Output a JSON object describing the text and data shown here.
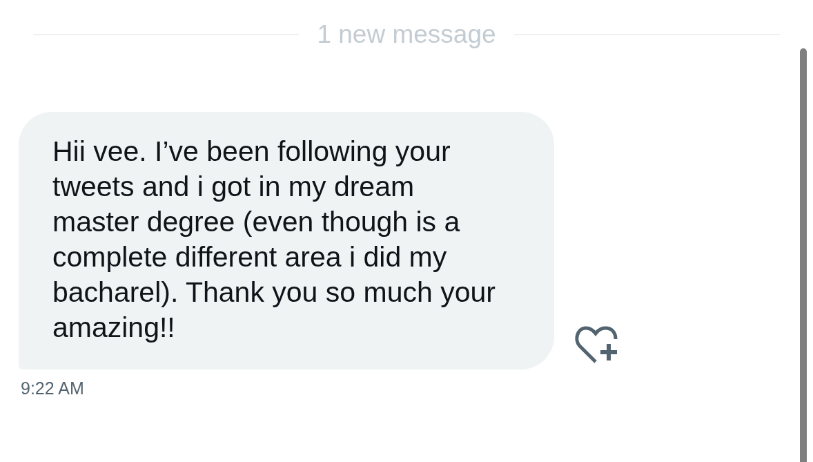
{
  "divider": {
    "label": "1 new message"
  },
  "messages": [
    {
      "text": "Hii vee. I’ve been following your tweets and i got in my dream master degree (even though is a complete different area i did my bacharel). Thank you so much your amazing!!",
      "time": "9:22 AM"
    }
  ]
}
